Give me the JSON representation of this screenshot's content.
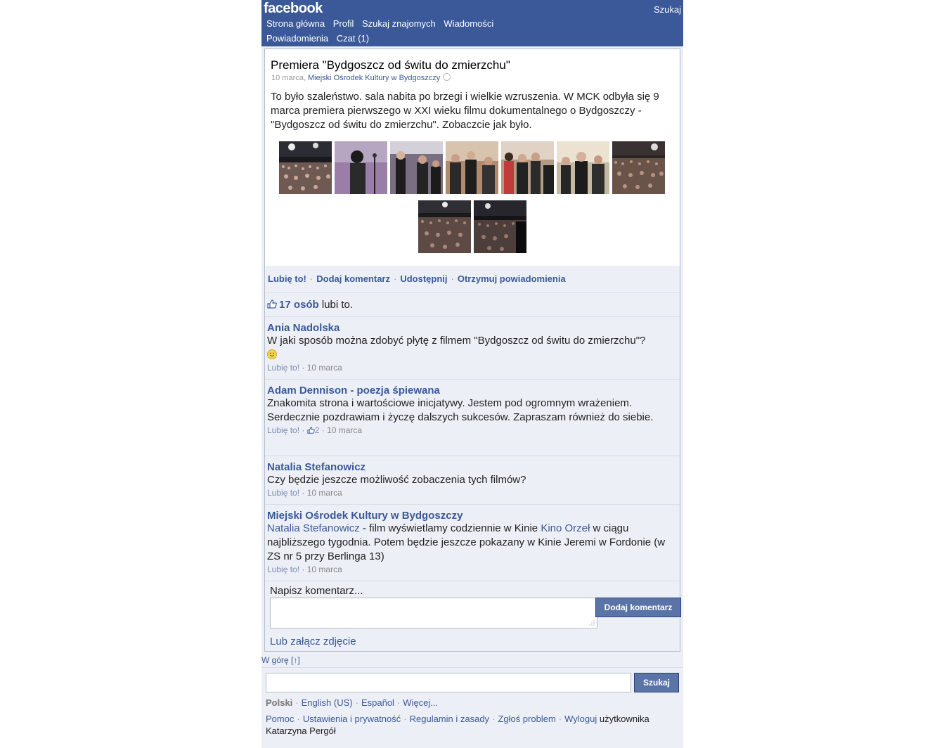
{
  "header": {
    "logo": "facebook",
    "search_label": "Szukaj",
    "nav_row1": [
      "Strona główna",
      "Profil",
      "Szukaj znajomych",
      "Wiadomości"
    ],
    "nav_row2": [
      "Powiadomienia",
      "Czat (1)"
    ]
  },
  "post": {
    "title": "Premiera \"Bydgoszcz od świtu do zmierzchu\"",
    "date": "10 marca",
    "author": "Miejski Ośrodek Kultury w Bydgoszczy",
    "message": "To było szaleństwo. sala nabita po brzegi i wielkie wzruszenia. W MCK odbyła się 9 marca premiera pierwszego w XXI wieku filmu dokumentalnego o Bydgoszczy - \"Bydgoszcz od świtu do zmierzchu\". Zobaczcie jak było.",
    "photo_count": 9
  },
  "actions": {
    "like": "Lubię to!",
    "comment": "Dodaj komentarz",
    "share": "Udostępnij",
    "notify": "Otrzymuj powiadomienia"
  },
  "likes": {
    "count": "17 osób",
    "suffix": "lubi to."
  },
  "comments": [
    {
      "name": "Ania Nadolska",
      "text": "W jaki sposób można zdobyć płytę z filmem \"Bydgoszcz od świtu do zmierzchu\"?",
      "like": "Lubię to!",
      "date": "10 marca"
    },
    {
      "name": "Adam Dennison - poezja śpiewana",
      "text": "Znakomita strona i wartościowe inicjatywy. Jestem pod ogromnym wrażeniem. Serdecznie pozdrawiam i życzę dalszych sukcesów. Zapraszam również do siebie.",
      "like": "Lubię to!",
      "like_count": "2",
      "date": "10 marca"
    },
    {
      "name": "Natalia Stefanowicz",
      "text": "Czy będzie jeszcze możliwość zobaczenia tych filmów?",
      "like": "Lubię to!",
      "date": "10 marca"
    },
    {
      "name": "Miejski Ośrodek Kultury w Bydgoszczy",
      "mention1": "Natalia Stefanowicz",
      "text_a": " - film wyświetlamy codziennie w Kinie ",
      "mention2": "Kino Orzeł",
      "text_b": " w ciągu najbliższego tygodnia. Potem będzie jeszcze pokazany w Kinie Jeremi w Fordonie (w ZS nr 5 przy Berlinga 13)",
      "like": "Lubię to!",
      "date": "10 marca"
    }
  ],
  "compose": {
    "label": "Napisz komentarz...",
    "button": "Dodaj komentarz",
    "attach": "Lub załącz zdjęcie"
  },
  "back_to_top": "W górę [↑]",
  "footer": {
    "search_button": "Szukaj",
    "languages": [
      "Polski",
      "English (US)",
      "Español",
      "Więcej..."
    ],
    "links": [
      "Pomoc",
      "Ustawienia i prywatność",
      "Regulamin i zasady",
      "Zgłoś problem"
    ],
    "logout": "Wyloguj",
    "logout_suffix": "użytkownika",
    "user": "Katarzyna Pergół"
  },
  "colors": {
    "brand": "#3b5998",
    "page_bg": "#eceff5",
    "button": "#5b74a8"
  }
}
